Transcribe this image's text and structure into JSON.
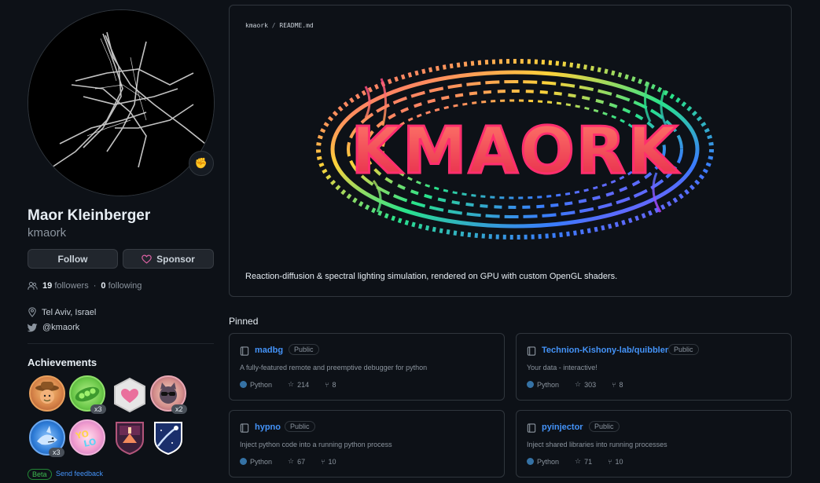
{
  "profile": {
    "fullname": "Maor Kleinberger",
    "username": "kmaork",
    "status_emoji": "✊",
    "follow_label": "Follow",
    "sponsor_label": "Sponsor",
    "followers_count": "19",
    "followers_label": "followers",
    "separator": "·",
    "following_count": "0",
    "following_label": "following",
    "location": "Tel Aviv, Israel",
    "twitter": "@kmaork"
  },
  "achievements": {
    "title": "Achievements",
    "badges": [
      {
        "name": "cowboy",
        "count": ""
      },
      {
        "name": "peas-pod",
        "count": "x3"
      },
      {
        "name": "heart-hexagon",
        "count": ""
      },
      {
        "name": "cat-sunglasses",
        "count": "x2"
      },
      {
        "name": "shark",
        "count": "x3"
      },
      {
        "name": "yolo",
        "count": ""
      },
      {
        "name": "arctic-shield",
        "count": ""
      },
      {
        "name": "starstruck-shield",
        "count": ""
      }
    ],
    "beta_label": "Beta",
    "feedback_label": "Send feedback"
  },
  "readme": {
    "owner": "kmaork",
    "sep": "/",
    "file": "README.md",
    "banner_text": "KMAORK",
    "description": "Reaction-diffusion & spectral lighting simulation, rendered on GPU with custom OpenGL shaders."
  },
  "pinned": {
    "title": "Pinned",
    "repos": [
      {
        "name": "madbg",
        "visibility": "Public",
        "description": "A fully-featured remote and preemptive debugger for python",
        "language": "Python",
        "stars": "214",
        "forks": "8"
      },
      {
        "name": "Technion-Kishony-lab/quibbler",
        "visibility": "Public",
        "description": "Your data - interactive!",
        "language": "Python",
        "stars": "303",
        "forks": "8"
      },
      {
        "name": "hypno",
        "visibility": "Public",
        "description": "Inject python code into a running python process",
        "language": "Python",
        "stars": "67",
        "forks": "10"
      },
      {
        "name": "pyinjector",
        "visibility": "Public",
        "description": "Inject shared libraries into running processes",
        "language": "Python",
        "stars": "71",
        "forks": "10"
      }
    ]
  },
  "colors": {
    "background": "#0d1117",
    "link": "#4493f8",
    "muted": "#8b949e",
    "python": "#3572A5",
    "sponsor_heart": "#db61a2"
  }
}
